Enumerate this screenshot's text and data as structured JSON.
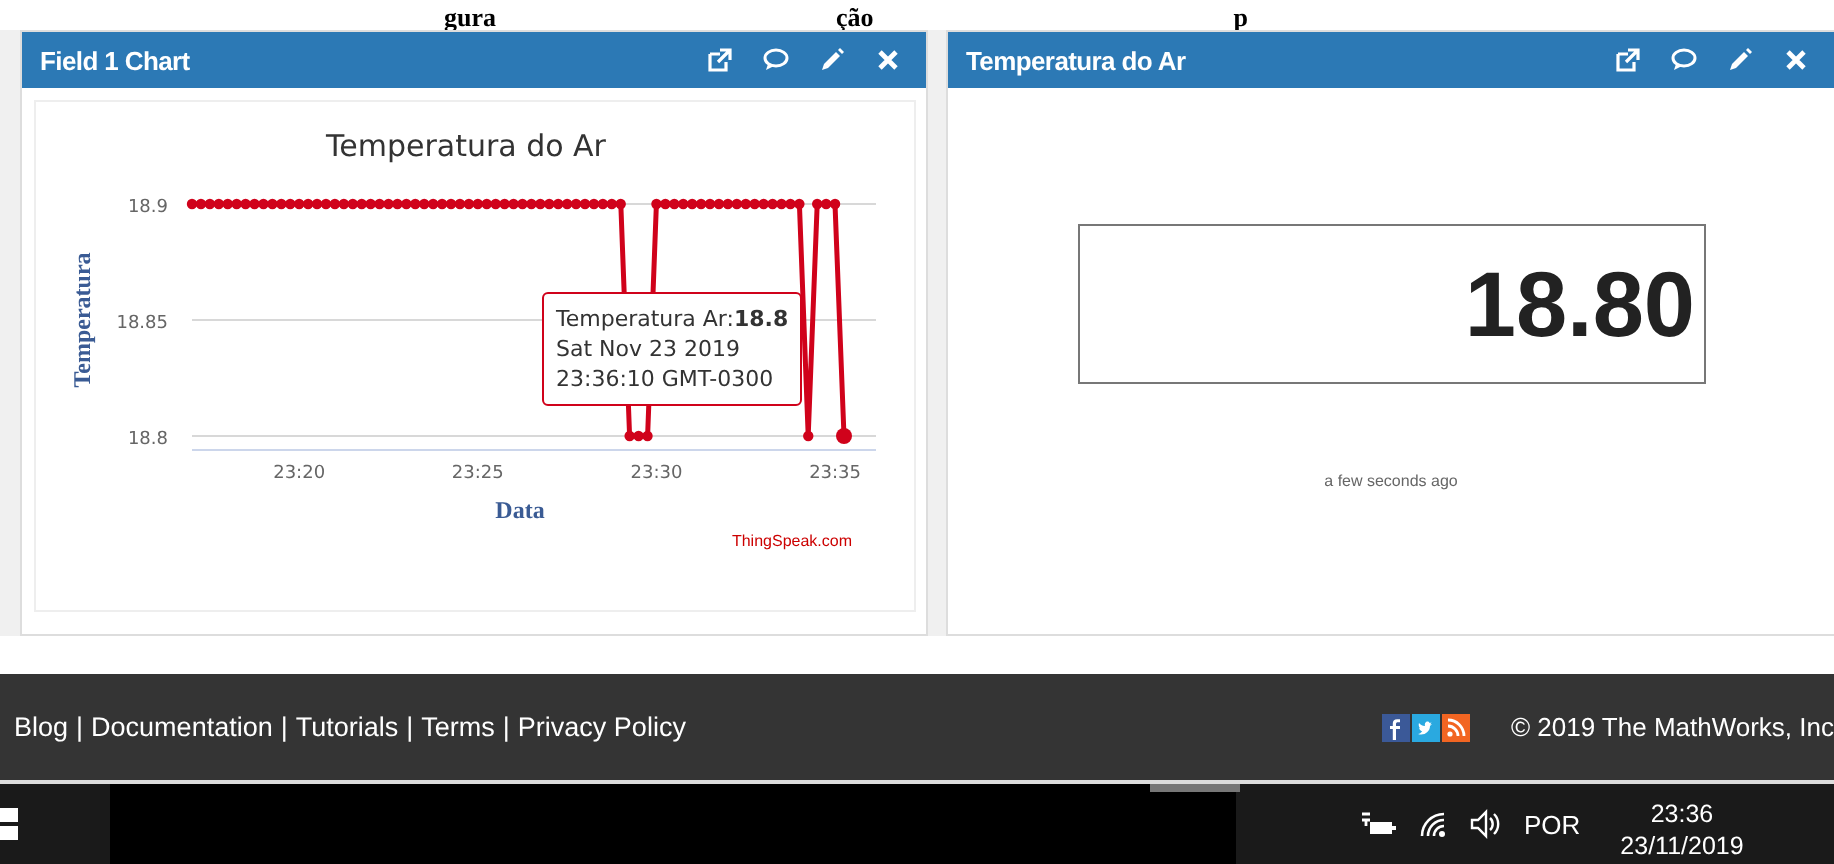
{
  "caption_fragments": [
    "gura",
    "ção",
    "p"
  ],
  "panels": [
    {
      "kind": "chart",
      "title": "Field 1 Chart",
      "chart_data": {
        "type": "line",
        "title": "Temperatura do Ar",
        "xlabel": "Data",
        "ylabel": "Temperatura",
        "ylim": [
          18.8,
          18.9
        ],
        "yticks": [
          {
            "value": 18.8,
            "label": "18.8"
          },
          {
            "value": 18.85,
            "label": "18.85"
          },
          {
            "value": 18.9,
            "label": "18.9"
          }
        ],
        "categories": [
          null,
          null,
          null,
          null,
          null,
          null,
          null,
          null,
          null,
          null,
          null,
          null,
          "23:20",
          null,
          null,
          null,
          null,
          null,
          null,
          null,
          null,
          null,
          null,
          null,
          null,
          null,
          null,
          null,
          null,
          null,
          null,
          null,
          "23:25",
          null,
          null,
          null,
          null,
          null,
          null,
          null,
          null,
          null,
          null,
          null,
          null,
          null,
          null,
          null,
          null,
          null,
          null,
          null,
          "23:30",
          null,
          null,
          null,
          null,
          null,
          null,
          null,
          null,
          null,
          null,
          null,
          null,
          null,
          null,
          null,
          null,
          null,
          null,
          null,
          "23:35",
          null
        ],
        "series": [
          {
            "color": "#d0021b",
            "marker": "circle",
            "values": [
              18.9,
              18.9,
              18.9,
              18.9,
              18.9,
              18.9,
              18.9,
              18.9,
              18.9,
              18.9,
              18.9,
              18.9,
              18.9,
              18.9,
              18.9,
              18.9,
              18.9,
              18.9,
              18.9,
              18.9,
              18.9,
              18.9,
              18.9,
              18.9,
              18.9,
              18.9,
              18.9,
              18.9,
              18.9,
              18.9,
              18.9,
              18.9,
              18.9,
              18.9,
              18.9,
              18.9,
              18.9,
              18.9,
              18.9,
              18.9,
              18.9,
              18.9,
              18.9,
              18.9,
              18.9,
              18.9,
              18.9,
              18.9,
              18.9,
              18.8,
              18.8,
              18.8,
              18.9,
              18.9,
              18.9,
              18.9,
              18.9,
              18.9,
              18.9,
              18.9,
              18.9,
              18.9,
              18.9,
              18.9,
              18.9,
              18.9,
              18.9,
              18.9,
              18.9,
              18.8,
              18.9,
              18.9,
              18.9,
              18.8
            ]
          }
        ]
      },
      "tooltip": {
        "lines": [
          "Temperatura Ar:**18.8**",
          "Sat Nov 23 2019",
          "23:36:10 GMT-0300"
        ]
      },
      "credit": "ThingSpeak.com"
    },
    {
      "kind": "numeric",
      "title": "Temperatura do Ar",
      "value": "18.80",
      "updated": "a few seconds ago"
    }
  ],
  "footer": {
    "links": [
      "Blog",
      "Documentation",
      "Tutorials",
      "Terms",
      "Privacy Policy"
    ],
    "separator": "|",
    "copyright": "© 2019 The MathWorks, Inc"
  },
  "taskbar": {
    "language": "POR",
    "time": "23:36",
    "date": "23/11/2019"
  }
}
